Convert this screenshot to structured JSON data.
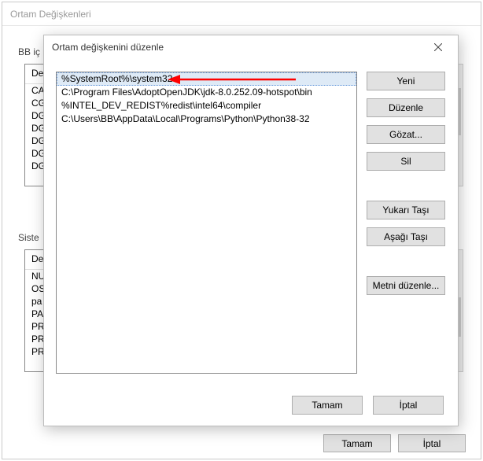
{
  "parent": {
    "title": "Ortam Değişkenleri",
    "user_group_label": "BB iç",
    "user_header": "De",
    "user_rows": [
      "CA",
      "CG",
      "DG",
      "DG",
      "DG",
      "DG",
      "DG"
    ],
    "sys_group_label": "Siste",
    "sys_header": "De",
    "sys_rows": [
      "NU",
      "OS",
      "pa",
      "PA",
      "PR",
      "PR",
      "PR"
    ],
    "ok_label": "Tamam",
    "cancel_label": "İptal"
  },
  "edit": {
    "title": "Ortam değişkenini düzenle",
    "paths": [
      "%SystemRoot%\\system32",
      "C:\\Program Files\\AdoptOpenJDK\\jdk-8.0.252.09-hotspot\\bin",
      "%INTEL_DEV_REDIST%redist\\intel64\\compiler",
      "C:\\Users\\BB\\AppData\\Local\\Programs\\Python\\Python38-32"
    ],
    "buttons": {
      "new": "Yeni",
      "editb": "Düzenle",
      "browse": "Gözat...",
      "del": "Sil",
      "up": "Yukarı Taşı",
      "down": "Aşağı Taşı",
      "edittext": "Metni düzenle..."
    },
    "ok_label": "Tamam",
    "cancel_label": "İptal"
  }
}
